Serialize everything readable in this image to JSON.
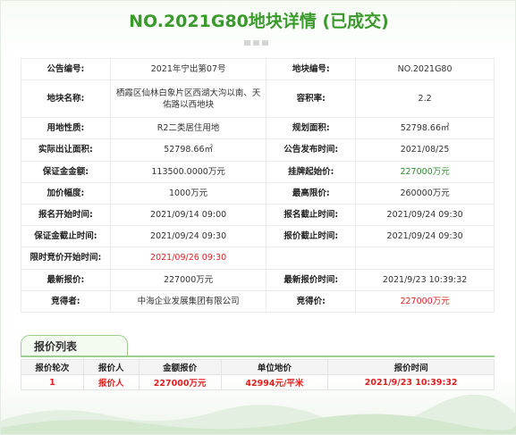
{
  "page": {
    "title": "NO.2021G80地块详情 (已成交)"
  },
  "details": {
    "rows": [
      [
        "公告编号:",
        "2021年宁出第07号",
        "地块编号:",
        "NO.2021G80"
      ],
      [
        "地块名称:",
        "栖霞区仙林白象片区西湖大沟以南、天佑路以西地块",
        "容积率:",
        "2.2"
      ],
      [
        "用地性质:",
        "R2二类居住用地",
        "规划面积:",
        "52798.66㎡"
      ],
      [
        "实际出让面积:",
        "52798.66㎡",
        "公告发布时间:",
        "2021/08/25"
      ],
      [
        "保证金金额:",
        "113500.0000万元",
        "挂牌起始价:",
        "227000万元"
      ],
      [
        "加价幅度:",
        "1000万元",
        "最高限价:",
        "260000万元"
      ],
      [
        "报名开始时间:",
        "2021/09/14 09:00",
        "报名截止时间:",
        "2021/09/24 09:30"
      ],
      [
        "保证金截止时间:",
        "2021/09/24 09:30",
        "报价截止时间:",
        "2021/09/24 09:30"
      ],
      [
        "限时竞价开始时间:",
        "2021/09/26 09:30",
        "",
        ""
      ],
      [
        "最新报价:",
        "227000万元",
        "最新报价时间:",
        "2021/9/23 10:39:32"
      ],
      [
        "竞得者:",
        "中海企业发展集团有限公司",
        "竞得价:",
        "227000万元"
      ]
    ]
  },
  "bids": {
    "tab_label": "报价列表",
    "headers": [
      "报价轮次",
      "报价人",
      "金额报价",
      "单位地价",
      "报价时间"
    ],
    "rows": [
      [
        "1",
        "报价人",
        "227000万元",
        "42994元/平米",
        "2021/9/23 10:39:32"
      ]
    ]
  },
  "colors": {
    "title": "#3a9a2c",
    "highlight_green": "#2e8b2e",
    "highlight_red": "#e02020"
  }
}
